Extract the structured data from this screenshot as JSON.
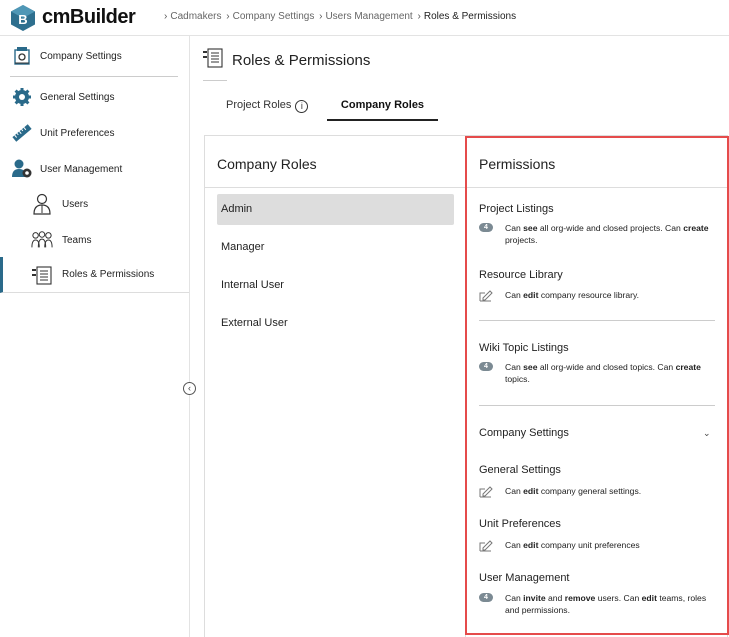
{
  "app": {
    "name": "cmBuilder",
    "logo_letter": "B"
  },
  "breadcrumb": [
    {
      "label": "Cadmakers"
    },
    {
      "label": "Company Settings"
    },
    {
      "label": "Users Management"
    },
    {
      "label": "Roles & Permissions"
    }
  ],
  "sidebar": {
    "items": [
      {
        "label": "Company Settings",
        "icon": "company-settings-icon"
      },
      {
        "label": "General Settings",
        "icon": "gear-icon"
      },
      {
        "label": "Unit Preferences",
        "icon": "ruler-icon"
      },
      {
        "label": "User Management",
        "icon": "user-management-icon"
      },
      {
        "label": "Users",
        "icon": "user-icon"
      },
      {
        "label": "Teams",
        "icon": "team-icon"
      },
      {
        "label": "Roles & Permissions",
        "icon": "roles-permissions-icon",
        "active": true
      }
    ],
    "collapse_glyph": "‹"
  },
  "page": {
    "title": "Roles & Permissions"
  },
  "tabs": [
    {
      "label": "Project Roles",
      "info_glyph": "i"
    },
    {
      "label": "Company Roles",
      "active": true
    }
  ],
  "roles_panel": {
    "title": "Company Roles",
    "roles": [
      "Admin",
      "Manager",
      "Internal User",
      "External User"
    ],
    "selected": "Admin"
  },
  "permissions_panel": {
    "title": "Permissions",
    "sections": [
      {
        "title": "Project Listings",
        "badge": "4",
        "pre": "Can ",
        "b1": "see",
        "mid": " all org-wide and closed projects. Can ",
        "b2": "create",
        "post": " projects."
      },
      {
        "title": "Resource Library",
        "icon": "edit-icon",
        "pre": "Can ",
        "b1": "edit",
        "mid": " company resource library."
      },
      {
        "title": "Wiki Topic Listings",
        "badge": "4",
        "pre": "Can ",
        "b1": "see",
        "mid": " all org-wide and closed topics. Can ",
        "b2": "create",
        "post": " topics."
      },
      {
        "title": "Company Settings",
        "collapsible": true,
        "chevron_glyph": "⌄"
      },
      {
        "title": "General Settings",
        "icon": "edit-icon",
        "pre": "Can ",
        "b1": "edit",
        "mid": " company general settings."
      },
      {
        "title": "Unit Preferences",
        "icon": "edit-icon",
        "pre": "Can ",
        "b1": "edit",
        "mid": " company unit preferences"
      },
      {
        "title": "User Management",
        "badge": "4",
        "pre": "Can ",
        "b1": "invite",
        "mid": " and ",
        "b2": "remove",
        "post": " users. Can ",
        "b3": "edit",
        "post2": " teams, roles and permissions."
      }
    ]
  },
  "colors": {
    "accent": "#2a6a8a",
    "highlight": "#e54b4b",
    "badge": "#7b8a93"
  }
}
